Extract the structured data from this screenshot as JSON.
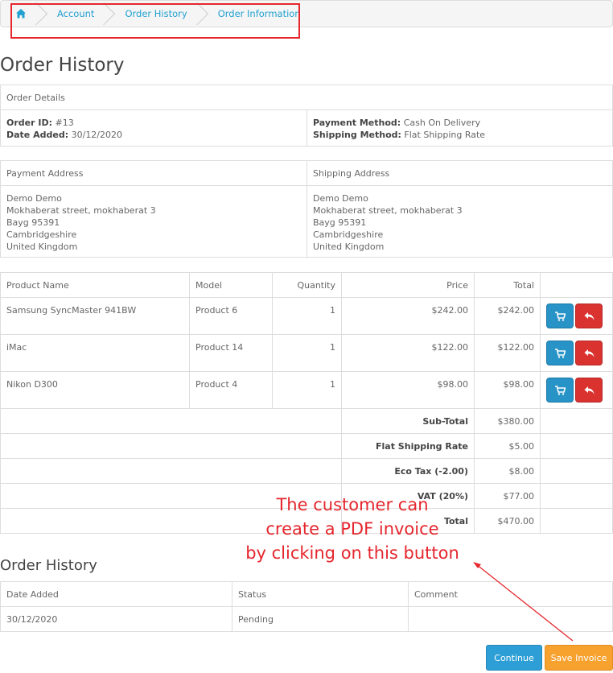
{
  "breadcrumb": {
    "items": [
      "Account",
      "Order History",
      "Order Information"
    ]
  },
  "page_title": "Order History",
  "order_details": {
    "header": "Order Details",
    "order_id_label": "Order ID:",
    "order_id": "#13",
    "date_added_label": "Date Added:",
    "date_added": "30/12/2020",
    "payment_method_label": "Payment Method:",
    "payment_method": "Cash On Delivery",
    "shipping_method_label": "Shipping Method:",
    "shipping_method": "Flat Shipping Rate"
  },
  "addresses": {
    "payment_header": "Payment Address",
    "shipping_header": "Shipping Address",
    "payment": [
      "Demo Demo",
      "Mokhaberat street, mokhaberat 3",
      "Bayg 95391",
      "Cambridgeshire",
      "United Kingdom"
    ],
    "shipping": [
      "Demo Demo",
      "Mokhaberat street, mokhaberat 3",
      "Bayg 95391",
      "Cambridgeshire",
      "United Kingdom"
    ]
  },
  "products": {
    "headers": [
      "Product Name",
      "Model",
      "Quantity",
      "Price",
      "Total"
    ],
    "rows": [
      {
        "name": "Samsung SyncMaster 941BW",
        "model": "Product 6",
        "qty": "1",
        "price": "$242.00",
        "total": "$242.00"
      },
      {
        "name": "iMac",
        "model": "Product 14",
        "qty": "1",
        "price": "$122.00",
        "total": "$122.00"
      },
      {
        "name": "Nikon D300",
        "model": "Product 4",
        "qty": "1",
        "price": "$98.00",
        "total": "$98.00"
      }
    ],
    "totals": [
      {
        "label": "Sub-Total",
        "value": "$380.00"
      },
      {
        "label": "Flat Shipping Rate",
        "value": "$5.00"
      },
      {
        "label": "Eco Tax (-2.00)",
        "value": "$8.00"
      },
      {
        "label": "VAT (20%)",
        "value": "$77.00"
      },
      {
        "label": "Total",
        "value": "$470.00"
      }
    ]
  },
  "history": {
    "title": "Order History",
    "headers": [
      "Date Added",
      "Status",
      "Comment"
    ],
    "rows": [
      {
        "date": "30/12/2020",
        "status": "Pending",
        "comment": ""
      }
    ]
  },
  "buttons": {
    "continue": "Continue",
    "save_invoice": "Save Invoice"
  },
  "annotation": {
    "lines": [
      "The customer can",
      "create a PDF invoice",
      "by clicking on this button"
    ],
    "color": "#e5262d"
  },
  "colors": {
    "link": "#23a1d1",
    "primary": "#2d9fd6",
    "danger": "#d9322f",
    "warning": "#f7a12e"
  },
  "icons": [
    "home-icon",
    "cart-icon",
    "reply-icon"
  ]
}
